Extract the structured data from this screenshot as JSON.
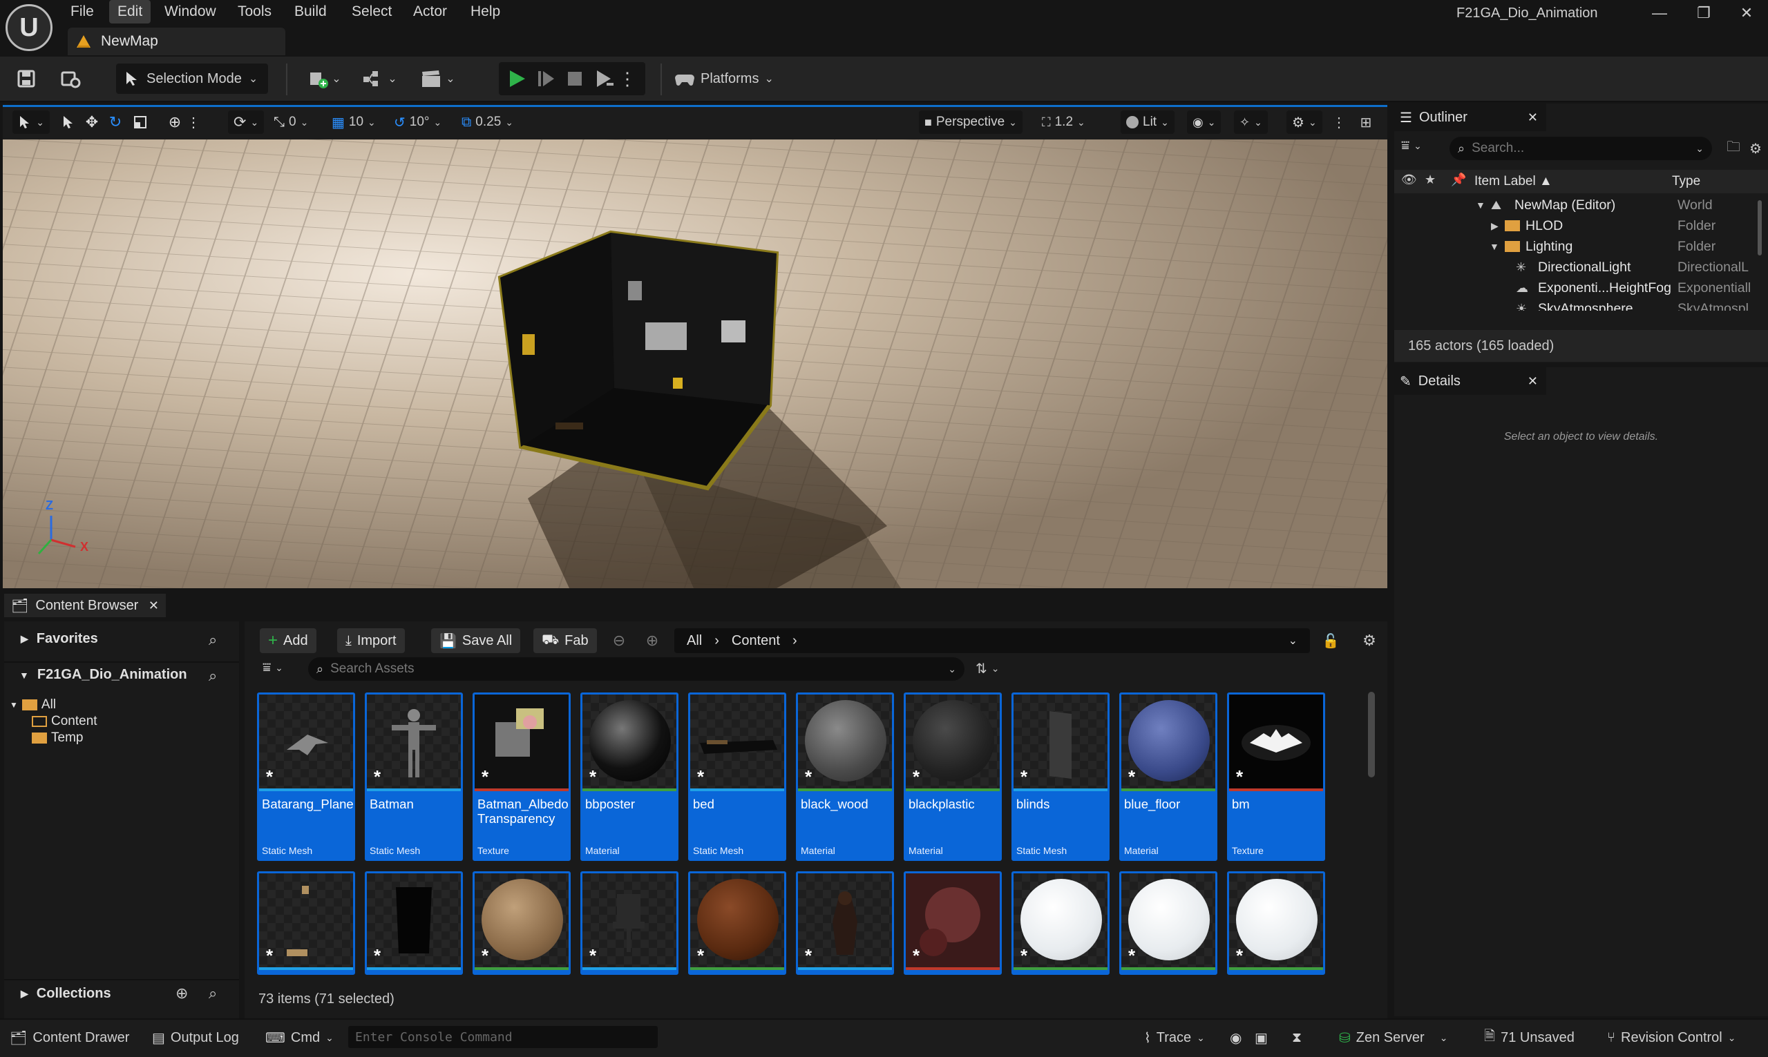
{
  "menu": [
    "File",
    "Edit",
    "Window",
    "Tools",
    "Build",
    "Select",
    "Actor",
    "Help"
  ],
  "map_tab": "NewMap",
  "project_name": "F21GA_Dio_Animation",
  "window_controls": {
    "minimize": "—",
    "restore": "❐",
    "close": "✕"
  },
  "toolbar": {
    "selection_mode": "Selection Mode",
    "platforms": "Platforms"
  },
  "viewport_toolbar": {
    "rotate_snap": "0",
    "grid_snap": "10",
    "angle_snap": "10°",
    "scale_snap": "0.25",
    "view": "Perspective",
    "camera_speed": "1.2",
    "view_mode": "Lit"
  },
  "axis": {
    "z": "Z",
    "x": "X"
  },
  "outliner": {
    "tab": "Outliner",
    "search_placeholder": "Search...",
    "col_label": "Item Label ▲",
    "col_type": "Type",
    "rows": [
      {
        "label": "NewMap (Editor)",
        "type": "World"
      },
      {
        "label": "HLOD",
        "type": "Folder"
      },
      {
        "label": "Lighting",
        "type": "Folder"
      },
      {
        "label": "DirectionalLight",
        "type": "DirectionalL"
      },
      {
        "label": "Exponenti...HeightFog",
        "type": "Exponentiall"
      },
      {
        "label": "SkyAtmosphere",
        "type": "SkyAtmospl"
      }
    ],
    "actors": "165 actors (165 loaded)"
  },
  "details": {
    "tab": "Details",
    "empty": "Select an object to view details."
  },
  "content_browser": {
    "tab": "Content Browser",
    "favorites": "Favorites",
    "project": "F21GA_Dio_Animation",
    "tree": [
      "All",
      "Content",
      "Temp"
    ],
    "collections": "Collections",
    "buttons": {
      "add": "Add",
      "import": "Import",
      "save_all": "Save All",
      "fab": "Fab"
    },
    "breadcrumb": [
      "All",
      "Content"
    ],
    "search_placeholder": "Search Assets",
    "status": "73 items (71 selected)",
    "assets": [
      {
        "name": "Batarang_Plane",
        "type": "Static Mesh",
        "color": "#1fa0e6"
      },
      {
        "name": "Batman",
        "type": "Static Mesh",
        "color": "#1fa0e6"
      },
      {
        "name": "Batman_Albedo Transparency",
        "type": "Texture",
        "color": "#c0392b"
      },
      {
        "name": "bbposter",
        "type": "Material",
        "color": "#3f9e3f"
      },
      {
        "name": "bed",
        "type": "Static Mesh",
        "color": "#1fa0e6"
      },
      {
        "name": "black_wood",
        "type": "Material",
        "color": "#3f9e3f"
      },
      {
        "name": "blackplastic",
        "type": "Material",
        "color": "#3f9e3f"
      },
      {
        "name": "blinds",
        "type": "Static Mesh",
        "color": "#1fa0e6"
      },
      {
        "name": "blue_floor",
        "type": "Material",
        "color": "#3f9e3f"
      },
      {
        "name": "bm",
        "type": "Texture",
        "color": "#c0392b"
      }
    ]
  },
  "statusbar": {
    "content_drawer": "Content Drawer",
    "output_log": "Output Log",
    "cmd": "Cmd",
    "console_placeholder": "Enter Console Command",
    "trace": "Trace",
    "zen": "Zen Server",
    "unsaved": "71 Unsaved",
    "revision": "Revision Control"
  }
}
